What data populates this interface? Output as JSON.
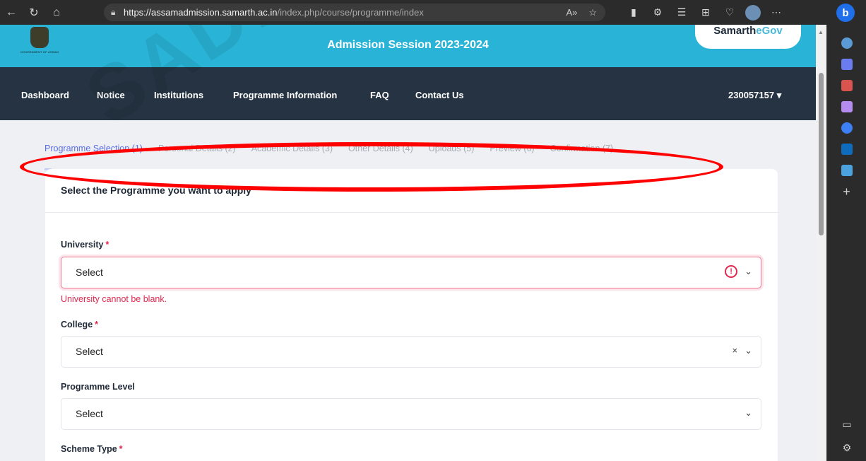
{
  "browser": {
    "url_host": "https://assamadmission.samarth.ac.in",
    "url_path": "/index.php/course/programme/index"
  },
  "header": {
    "emblem_caption": "GOVERNMENT OF ASSAM",
    "session_title": "Admission Session 2023-2024",
    "brand_main": "Samarth",
    "brand_accent": "eGov"
  },
  "nav": {
    "items": [
      "Dashboard",
      "Notice",
      "Institutions",
      "Programme Information",
      "FAQ",
      "Contact Us"
    ],
    "user_id": "230057157"
  },
  "steps": [
    {
      "label": "Programme Selection  (1)",
      "active": true
    },
    {
      "label": "Personal Details  (2)",
      "active": false
    },
    {
      "label": "Academic Details  (3)",
      "active": false
    },
    {
      "label": "Other Details  (4)",
      "active": false
    },
    {
      "label": "Uploads  (5)",
      "active": false
    },
    {
      "label": "Preview  (6)",
      "active": false
    },
    {
      "label": "Confirmation  (7)",
      "active": false
    }
  ],
  "form": {
    "title": "Select the Programme you want to apply",
    "university": {
      "label": "University",
      "value": "Select",
      "error": "University cannot be blank."
    },
    "college": {
      "label": "College",
      "value": "Select"
    },
    "programme_level": {
      "label": "Programme Level",
      "value": "Select"
    },
    "scheme_type": {
      "label": "Scheme Type"
    }
  },
  "watermark": "SADIYA",
  "colors": {
    "banner": "#29b3d6",
    "navbar": "#253342",
    "active_step": "#5b6fe6",
    "error": "#e0294f",
    "highlight": "#ff0000"
  },
  "icons": {
    "toolbar": [
      "back-icon",
      "refresh-icon",
      "home-icon",
      "lock-icon",
      "read-aloud-icon",
      "favorite-icon",
      "reading-view-icon",
      "extensions-icon",
      "favorites-bar-icon",
      "collections-icon",
      "health-icon",
      "profile-icon",
      "more-icon",
      "bing-icon"
    ],
    "sidebar": [
      "search-icon",
      "tag-icon",
      "toolbox-icon",
      "people-icon",
      "copilot-icon",
      "outlook-icon",
      "send-icon",
      "add-icon",
      "sidebar-toggle-icon",
      "settings-icon"
    ]
  }
}
